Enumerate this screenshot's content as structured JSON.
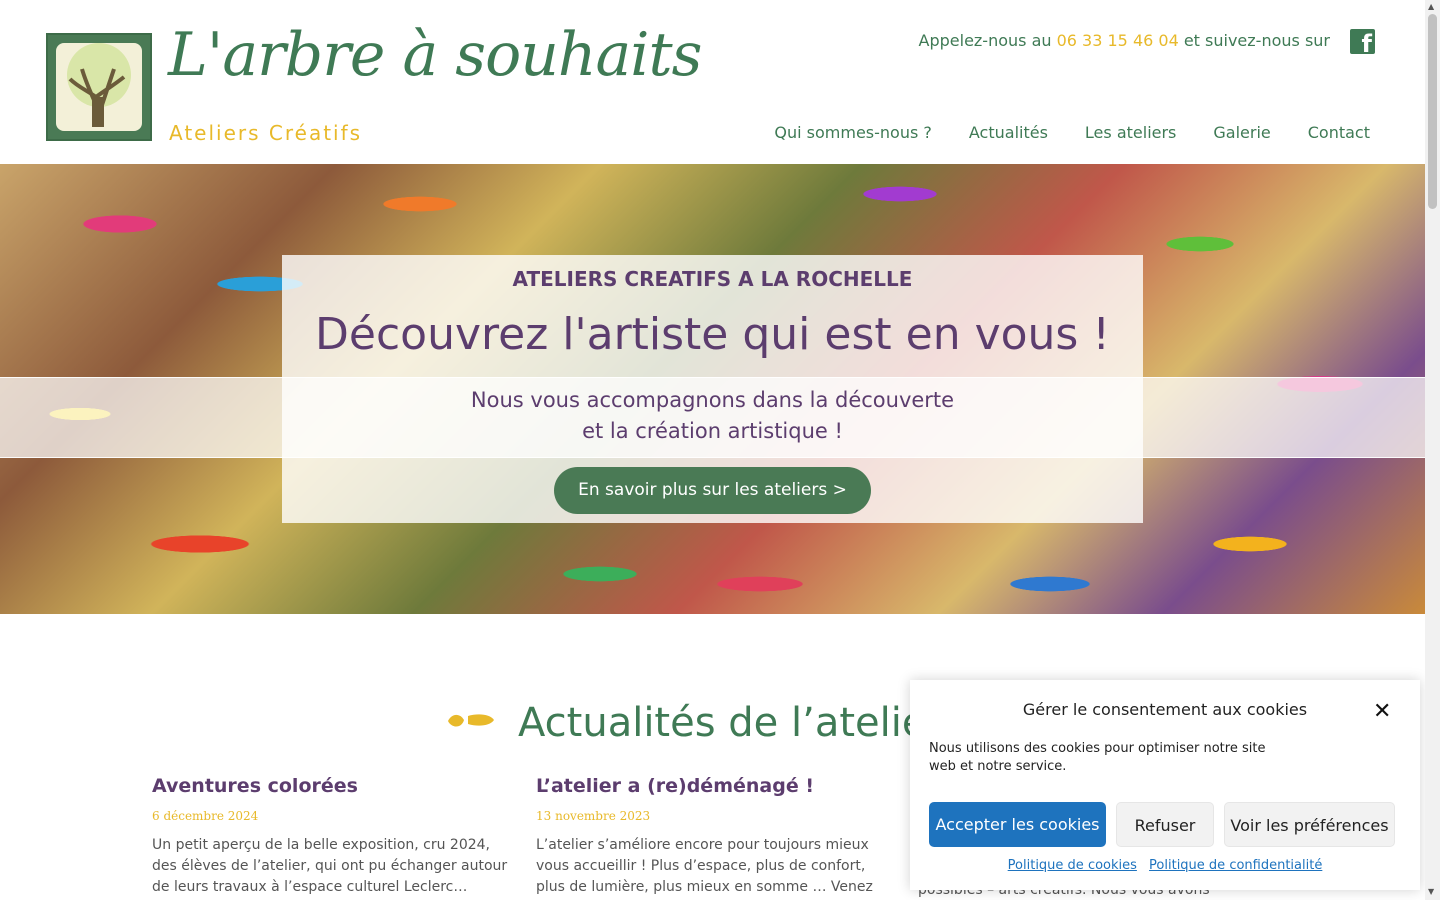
{
  "brand": {
    "title": "L'arbre à souhaits",
    "subtitle": "Ateliers Créatifs"
  },
  "topbar": {
    "prefix": "Appelez-nous au ",
    "phone": "06 33 15 46 04",
    "suffix": " et suivez-nous sur",
    "social_icon": "facebook-icon"
  },
  "nav": {
    "items": [
      {
        "label": "Qui sommes-nous ?"
      },
      {
        "label": "Actualités"
      },
      {
        "label": "Les ateliers"
      },
      {
        "label": "Galerie"
      },
      {
        "label": "Contact"
      }
    ]
  },
  "hero": {
    "kicker": "ATELIERS CREATIFS A LA ROCHELLE",
    "title": "Découvrez l'artiste qui est en vous !",
    "text_line1": "Nous vous accompagnons dans la découverte",
    "text_line2": "et la création artistique !",
    "button": "En savoir plus sur les ateliers >"
  },
  "news": {
    "title": "Actualités de l’atelier",
    "posts": [
      {
        "title": "Aventures colorées",
        "date": "6 décembre 2024",
        "excerpt": "Un petit aperçu de la belle exposition, cru 2024, des élèves de l’atelier, qui ont pu échanger autour de leurs travaux à l’espace culturel Leclerc…"
      },
      {
        "title": "L’atelier a (re)déménagé !",
        "date": "13 novembre 2023",
        "excerpt": "L’atelier s’améliore encore pour toujours mieux vous accueillir ! Plus d’espace, plus de confort, plus de lumière, plus mieux en somme … Venez"
      }
    ],
    "post3_visible_text": "possibles – arts créatifs. Nous vous avons"
  },
  "cookie": {
    "title": "Gérer le consentement aux cookies",
    "text": "Nous utilisons des cookies pour optimiser notre site web et notre service.",
    "accept": "Accepter les cookies",
    "refuse": "Refuser",
    "prefs": "Voir les préférences",
    "link_cookies": "Politique de cookies",
    "link_privacy": "Politique de confidentialité",
    "close_icon": "close-icon"
  },
  "colors": {
    "green": "#3f7a55",
    "yellow": "#e8b92a",
    "purple": "#5c3d6e",
    "blue": "#1e73be"
  }
}
